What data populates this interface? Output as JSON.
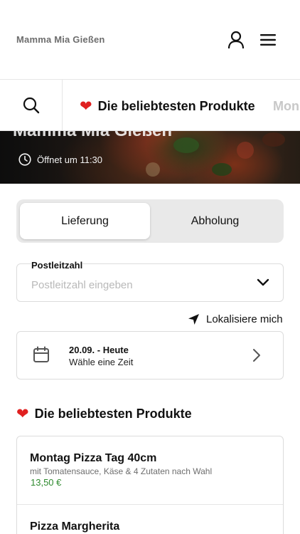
{
  "header": {
    "brand": "Mamma Mia Gießen"
  },
  "category_bar": {
    "tabs": [
      {
        "label": "Die beliebtesten Produkte",
        "active": true
      },
      {
        "label": "Mon",
        "active": false
      }
    ]
  },
  "hero": {
    "title": "Mamma Mia Gießen",
    "hours": "Öffnet um 11:30"
  },
  "mode": {
    "delivery": "Lieferung",
    "pickup": "Abholung",
    "selected": "Lieferung"
  },
  "postal": {
    "label": "Postleitzahl",
    "placeholder": "Postleitzahl eingeben",
    "value": ""
  },
  "locate": {
    "label": "Lokalisiere mich"
  },
  "date": {
    "main": "20.09. - Heute",
    "sub": "Wähle eine Zeit"
  },
  "section": {
    "title": "Die beliebtesten Produkte"
  },
  "products": [
    {
      "name": "Montag Pizza Tag 40cm",
      "description": "mit Tomatensauce, Käse & 4 Zutaten nach Wahl",
      "price": "13,50 €"
    },
    {
      "name": "Pizza Margherita"
    }
  ],
  "colors": {
    "accent_heart": "#e02020",
    "price_green": "#2f8a2f",
    "toggle_bg": "#e9e9e9"
  },
  "icons": [
    "user-icon",
    "menu-icon",
    "search-icon",
    "heart-icon",
    "clock-icon",
    "chevron-down-icon",
    "location-arrow-icon",
    "calendar-icon",
    "chevron-right-icon"
  ]
}
